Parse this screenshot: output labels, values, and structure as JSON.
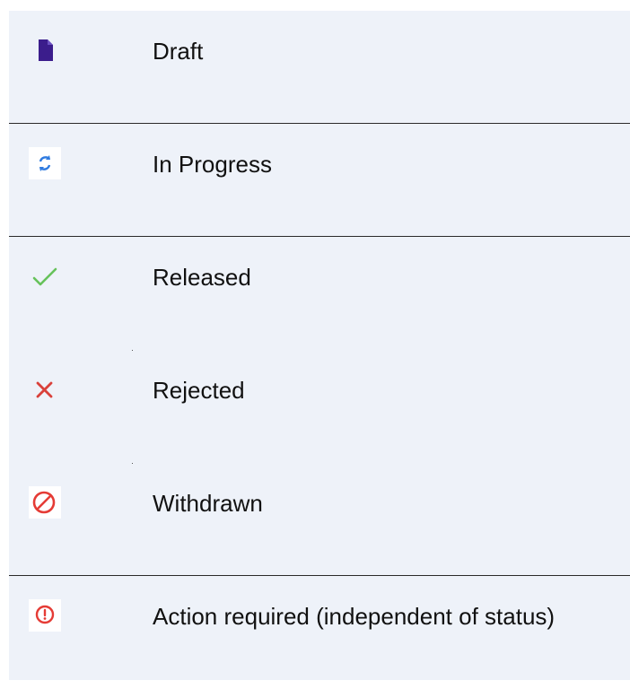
{
  "legend": {
    "items": [
      {
        "label": "Draft",
        "icon": "document-icon",
        "color": "#3b1d8c"
      },
      {
        "label": "In Progress",
        "icon": "sync-icon",
        "color": "#2f7be0"
      },
      {
        "label": "Released",
        "icon": "check-icon",
        "color": "#66c25b"
      },
      {
        "label": "Rejected",
        "icon": "close-icon",
        "color": "#d9413b"
      },
      {
        "label": "Withdrawn",
        "icon": "prohibited-icon",
        "color": "#e53b35"
      },
      {
        "label": "Action required (independent of status)",
        "icon": "alert-circle-icon",
        "color": "#e53b35"
      }
    ]
  }
}
